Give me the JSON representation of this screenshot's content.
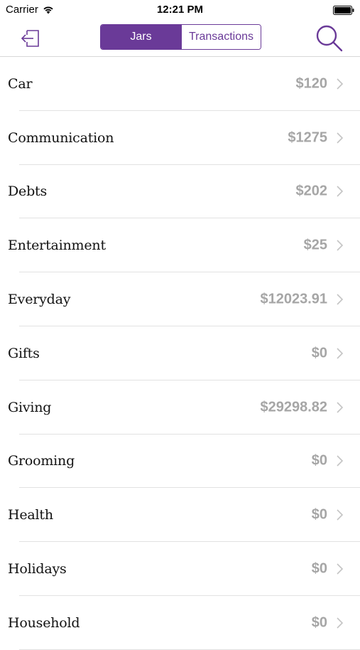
{
  "status_bar": {
    "carrier": "Carrier",
    "time": "12:21 PM"
  },
  "nav": {
    "back_icon": "logout-arrow-icon",
    "segments": {
      "active": "Jars",
      "inactive": "Transactions"
    },
    "search_icon": "search-icon"
  },
  "colors": {
    "accent": "#6a3a98",
    "amount": "#a6a6a6",
    "divider": "#e2e2e2"
  },
  "jars": [
    {
      "name": "Car",
      "amount": "$120"
    },
    {
      "name": "Communication",
      "amount": "$1275"
    },
    {
      "name": "Debts",
      "amount": "$202"
    },
    {
      "name": "Entertainment",
      "amount": "$25"
    },
    {
      "name": "Everyday",
      "amount": "$12023.91"
    },
    {
      "name": "Gifts",
      "amount": "$0"
    },
    {
      "name": "Giving",
      "amount": "$29298.82"
    },
    {
      "name": "Grooming",
      "amount": "$0"
    },
    {
      "name": "Health",
      "amount": "$0"
    },
    {
      "name": "Holidays",
      "amount": "$0"
    },
    {
      "name": "Household",
      "amount": "$0"
    }
  ]
}
